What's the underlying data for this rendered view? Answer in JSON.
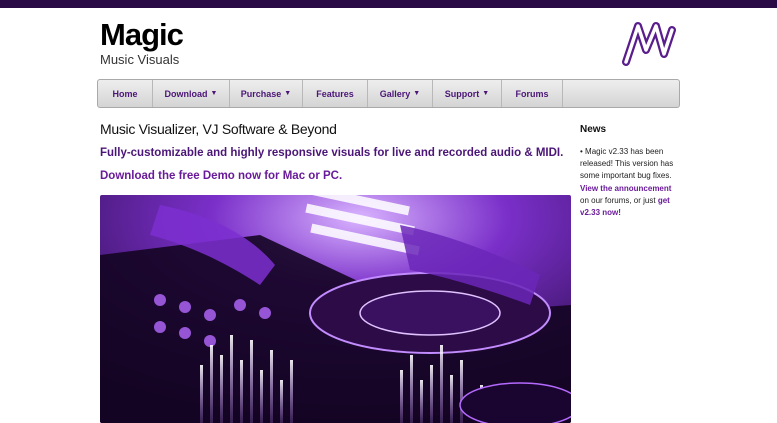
{
  "brand": {
    "title": "Magic",
    "subtitle": "Music Visuals"
  },
  "nav": {
    "items": [
      {
        "label": "Home",
        "dropdown": false
      },
      {
        "label": "Download",
        "dropdown": true
      },
      {
        "label": "Purchase",
        "dropdown": true
      },
      {
        "label": "Features",
        "dropdown": false
      },
      {
        "label": "Gallery",
        "dropdown": true
      },
      {
        "label": "Support",
        "dropdown": true
      },
      {
        "label": "Forums",
        "dropdown": false
      }
    ]
  },
  "main": {
    "headline": "Music Visualizer, VJ Software & Beyond",
    "tagline": "Fully-customizable and highly responsive visuals for live and recorded audio & MIDI.",
    "demo_link": "Download the free Demo now for Mac or PC."
  },
  "news": {
    "title": "News",
    "p1": "• Magic v2.33 has been released! This version has some important bug fixes.",
    "link1": "View the announcement",
    "p2": " on our forums, or just ",
    "link2": "get v2.33 now!"
  },
  "colors": {
    "accent": "#4b1677",
    "link": "#6a1b9a",
    "topbar": "#2a0a44"
  },
  "icons": {
    "logo": "magic-m-logo-icon",
    "caret": "caret-down-icon"
  }
}
